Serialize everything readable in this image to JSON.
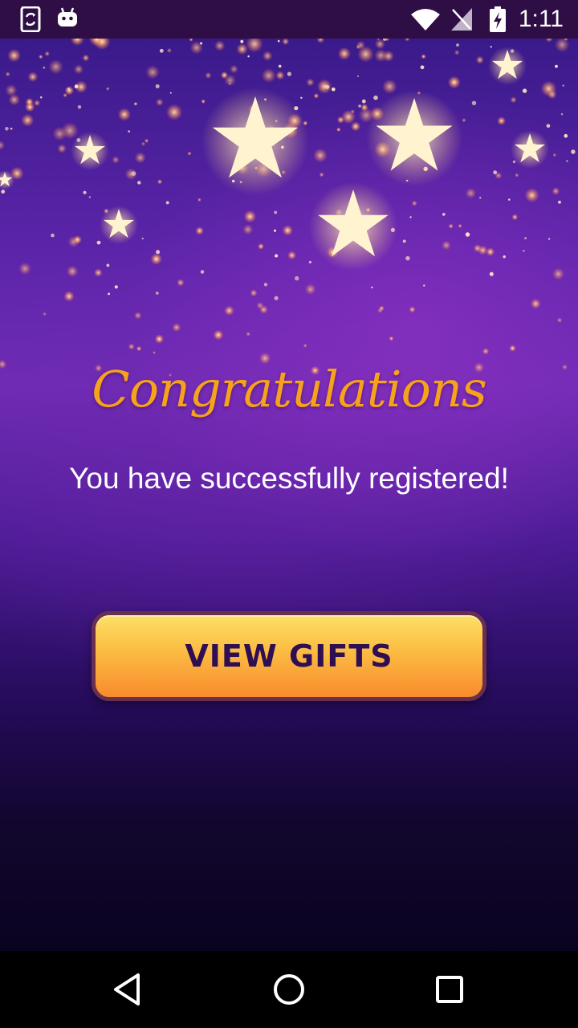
{
  "status_bar": {
    "time": "1:11",
    "left_icons": [
      "phone-sync-icon",
      "android-icon"
    ],
    "right_icons": [
      "wifi-icon",
      "no-signal-icon",
      "battery-charging-icon"
    ]
  },
  "content": {
    "title": "Congratulations",
    "message": "You have successfully registered!",
    "button_label": "VIEW GIFTS"
  },
  "nav_bar": {
    "buttons": [
      "back-icon",
      "home-icon",
      "recents-icon"
    ]
  },
  "colors": {
    "title": "#f6a21b",
    "button_text": "#2f0f52",
    "button_top": "#fde066",
    "button_bottom": "#f98b2c",
    "status_bar": "#2f0d45"
  }
}
